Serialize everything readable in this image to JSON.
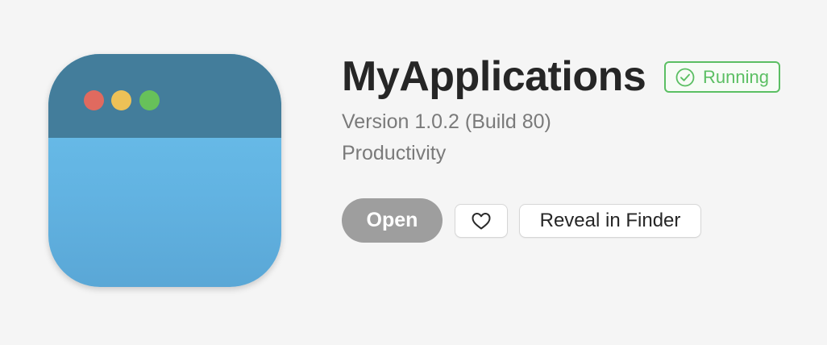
{
  "app": {
    "name": "MyApplications",
    "version": "Version 1.0.2 (Build 80)",
    "category": "Productivity",
    "icon": "app-window-icon"
  },
  "status": {
    "label": "Running",
    "icon": "check-circle-icon",
    "color": "#5bbf63"
  },
  "actions": {
    "open_label": "Open",
    "favorite_icon": "heart-icon",
    "reveal_label": "Reveal in Finder"
  },
  "colors": {
    "icon_titlebar": "#437d9b",
    "icon_body": "#62b3e2",
    "open_button_bg": "#9e9e9e",
    "background": "#f5f5f5"
  }
}
